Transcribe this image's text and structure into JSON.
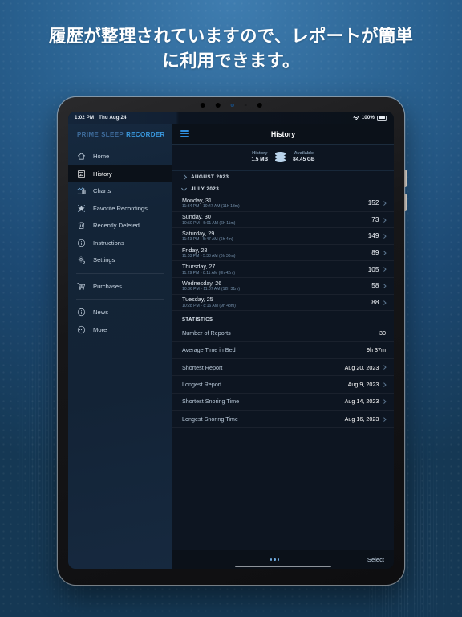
{
  "headline": "履歴が整理されていますので、レポートが簡単に利用できます。",
  "status_bar": {
    "time": "1:02 PM",
    "date": "Thu Aug 24",
    "battery": "100%",
    "wifi_icon": "wifi-icon",
    "battery_icon": "battery-icon"
  },
  "brand": {
    "word1": "PRIME",
    "word2": "SLEEP",
    "word3": "RECORDER"
  },
  "sidebar": {
    "items": [
      {
        "label": "Home",
        "icon": "home-icon",
        "active": false
      },
      {
        "label": "History",
        "icon": "history-icon",
        "active": true
      },
      {
        "label": "Charts",
        "icon": "charts-icon",
        "active": false
      },
      {
        "label": "Favorite Recordings",
        "icon": "star-icon",
        "active": false
      },
      {
        "label": "Recently Deleted",
        "icon": "trash-icon",
        "active": false
      },
      {
        "label": "Instructions",
        "icon": "info-icon",
        "active": false
      },
      {
        "label": "Settings",
        "icon": "gear-icon",
        "active": false
      }
    ],
    "group2": [
      {
        "label": "Purchases",
        "icon": "cart-icon"
      }
    ],
    "group3": [
      {
        "label": "News",
        "icon": "news-icon"
      },
      {
        "label": "More",
        "icon": "ellipsis-icon"
      }
    ]
  },
  "navbar": {
    "title": "History",
    "menu_icon": "hamburger-icon"
  },
  "storage": {
    "history_label": "History",
    "history_value": "1.5 MB",
    "available_label": "Available",
    "available_value": "84.45 GB",
    "icon": "database-icon"
  },
  "sections": [
    {
      "title": "AUGUST 2023",
      "expanded": false,
      "rows": []
    },
    {
      "title": "JULY 2023",
      "expanded": true,
      "rows": [
        {
          "day": "Monday, 31",
          "range": "11:34 PM - 10:47 AM  (11h 13m)",
          "count": "152"
        },
        {
          "day": "Sunday, 30",
          "range": "10:50 PM - 5:01 AM  (6h 11m)",
          "count": "73"
        },
        {
          "day": "Saturday, 29",
          "range": "11:43 PM - 5:47 AM  (6h 4m)",
          "count": "149"
        },
        {
          "day": "Friday, 28",
          "range": "11:03 PM - 5:33 AM  (6h 30m)",
          "count": "89"
        },
        {
          "day": "Thursday, 27",
          "range": "11:29 PM - 8:11 AM  (8h 42m)",
          "count": "105"
        },
        {
          "day": "Wednesday, 26",
          "range": "10:36 PM - 11:07 AM  (12h 31m)",
          "count": "58"
        },
        {
          "day": "Tuesday, 25",
          "range": "10:28 PM - 8:16 AM  (9h 48m)",
          "count": "88"
        }
      ]
    }
  ],
  "statistics": {
    "title": "STATISTICS",
    "rows": [
      {
        "label": "Number of Reports",
        "value": "30",
        "arrow": false
      },
      {
        "label": "Average Time in Bed",
        "value": "9h 37m",
        "arrow": false
      },
      {
        "label": "Shortest Report",
        "value": "Aug 20, 2023",
        "arrow": true
      },
      {
        "label": "Longest Report",
        "value": "Aug 9, 2023",
        "arrow": true
      },
      {
        "label": "Shortest Snoring Time",
        "value": "Aug 14, 2023",
        "arrow": true
      },
      {
        "label": "Longest Snoring Time",
        "value": "Aug 16, 2023",
        "arrow": true
      }
    ]
  },
  "toolbar": {
    "more_icon": "ellipsis-icon",
    "select_label": "Select"
  },
  "colors": {
    "accent": "#2f8ddb",
    "brand_bright": "#3a9ae0",
    "background": "#1d4f7c",
    "screen_bg": "#0d1521"
  }
}
